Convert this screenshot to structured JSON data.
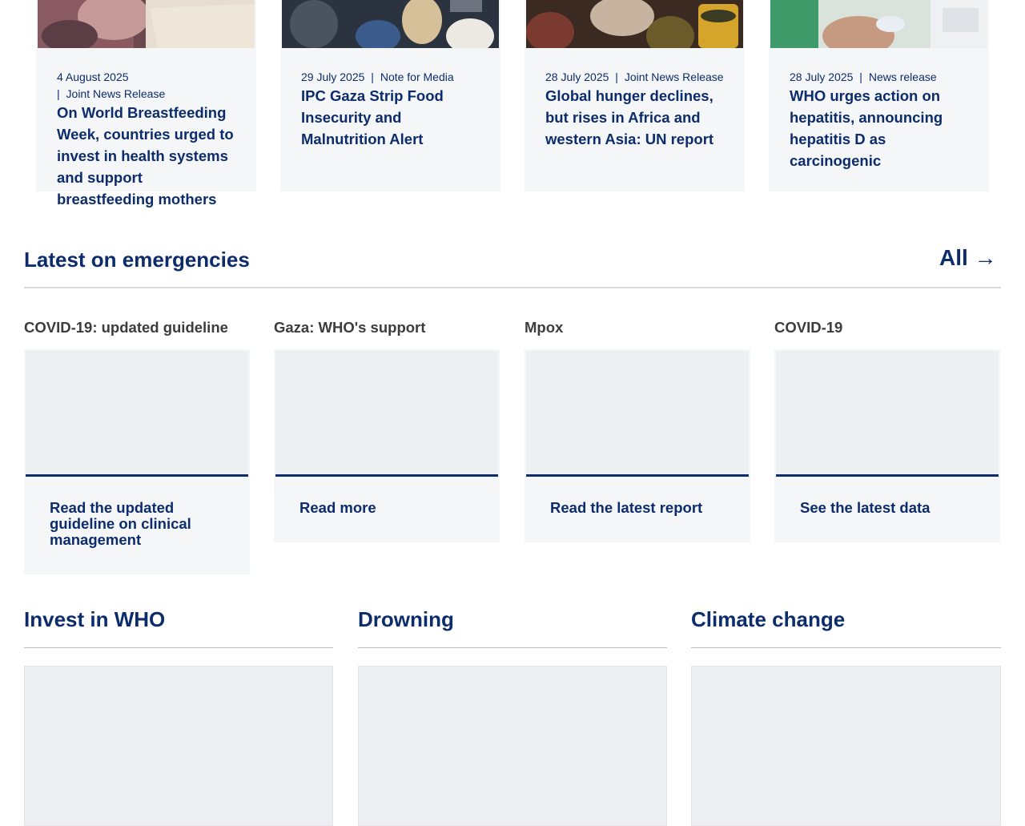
{
  "news": [
    {
      "date": "4 August 2025",
      "separator": "|",
      "type": "Joint News Release",
      "title": "On World Breastfeeding Week, countries urged to invest in health systems and support breastfeeding mothers"
    },
    {
      "date": "29 July 2025",
      "separator": "|",
      "type": "Note for Media",
      "title": "IPC Gaza Strip Food Insecurity and Malnutrition Alert"
    },
    {
      "date": "28 July 2025",
      "separator": "|",
      "type": "Joint News Release",
      "title": "Global hunger declines, but rises in Africa and western Asia: UN report"
    },
    {
      "date": "28 July 2025",
      "separator": "|",
      "type": "News release",
      "title": "WHO urges action on hepatitis, announcing hepatitis D as carcinogenic"
    }
  ],
  "emergencies": {
    "heading": "Latest on emergencies",
    "all_link": "All →",
    "items": [
      {
        "label": "COVID-19: updated guideline",
        "cta": "Read the updated guideline on clinical management"
      },
      {
        "label": "Gaza: WHO's support",
        "cta": "Read more"
      },
      {
        "label": "Mpox",
        "cta": "Read the latest report"
      },
      {
        "label": "COVID-19",
        "cta": "See the latest data"
      }
    ]
  },
  "bottom_sections": [
    {
      "heading": "Invest in WHO"
    },
    {
      "heading": "Drowning"
    },
    {
      "heading": "Climate change"
    }
  ],
  "colors": {
    "brand": "#0d2c6c",
    "card_bg": "#f4f6f8",
    "image_placeholder": "#edeff3"
  }
}
